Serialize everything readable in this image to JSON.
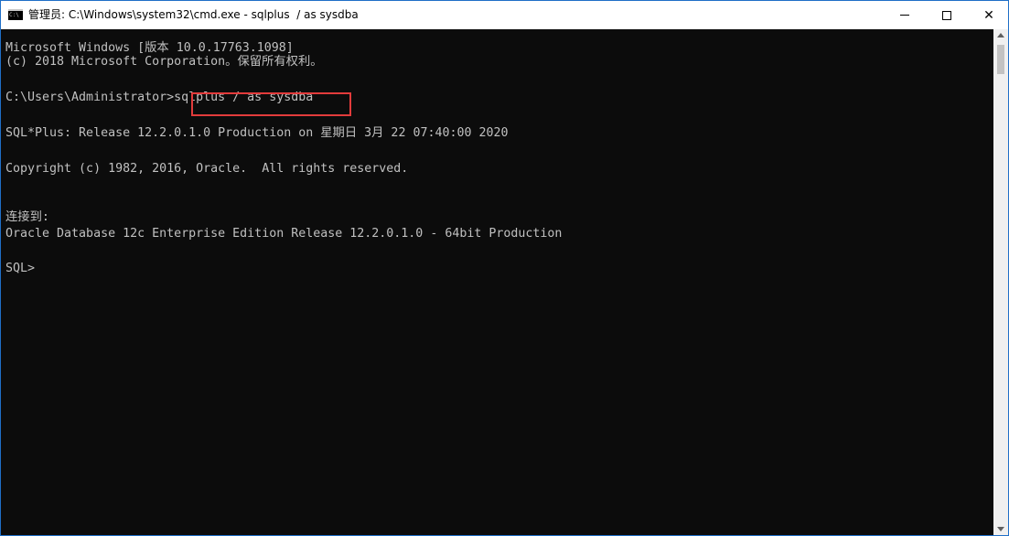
{
  "window": {
    "title": "管理员: C:\\Windows\\system32\\cmd.exe - sqlplus  / as sysdba",
    "icon": "cmd-console-icon",
    "icon_text": "C:\\",
    "controls": {
      "minimize": "minimize-icon",
      "maximize": "maximize-icon",
      "close": "✕"
    }
  },
  "console": {
    "lines": [
      "Microsoft Windows [版本 10.0.17763.1098]",
      "(c) 2018 Microsoft Corporation。保留所有权利。",
      "C:\\Users\\Administrator>sqlplus / as sysdba",
      "SQL*Plus: Release 12.2.0.1.0 Production on 星期日 3月 22 07:40:00 2020",
      "Copyright (c) 1982, 2016, Oracle.  All rights reserved.",
      "连接到:",
      "Oracle Database 12c Enterprise Edition Release 12.2.0.1.0 - 64bit Production",
      "SQL>"
    ],
    "highlighted_command": "sqlplus / as sysdba",
    "colors": {
      "background": "#0c0c0c",
      "text": "#c0c0c0",
      "highlight_border": "#e23b3b"
    }
  }
}
